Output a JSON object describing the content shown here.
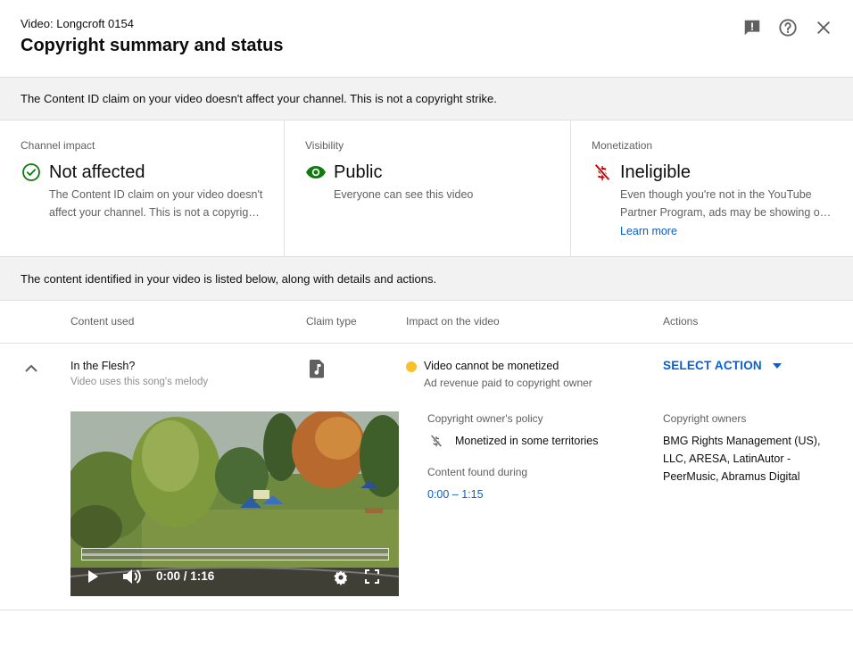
{
  "header": {
    "video_label": "Video: Longcroft 0154",
    "title": "Copyright summary and status",
    "icons": [
      "feedback-icon",
      "help-icon",
      "close-icon"
    ]
  },
  "notice": "The Content ID claim on your video doesn't affect your channel. This is not a copyright strike.",
  "cards": [
    {
      "label": "Channel impact",
      "icon": "check-circle-icon",
      "value": "Not affected",
      "description": "The Content ID claim on your video doesn't affect your channel. This is not a copyright strike."
    },
    {
      "label": "Visibility",
      "icon": "eye-icon",
      "value": "Public",
      "description": "Everyone can see this video"
    },
    {
      "label": "Monetization",
      "icon": "no-money-icon",
      "value": "Ineligible",
      "description": "Even though you're not in the YouTube Partner Program, ads may be showing on your video.",
      "link": "Learn more"
    }
  ],
  "content_notice": "The content identified in your video is listed below, along with details and actions.",
  "table": {
    "headers": [
      "Content used",
      "Claim type",
      "Impact on the video",
      "Actions"
    ],
    "rows": [
      {
        "title": "In the Flesh?",
        "subtitle": "Video uses this song's melody",
        "claim_type_icon": "music-note-icon",
        "impact": "Video cannot be monetized",
        "impact_sub": "Ad revenue paid to copyright owner",
        "action_label": "SELECT ACTION",
        "video": {
          "time": "0:00 / 1:16",
          "progress": 0.0
        },
        "policy_label": "Copyright owner's policy",
        "policy": "Monetized in some territories",
        "found_label": "Content found during",
        "found": "0:00 – 1:15",
        "owners_label": "Copyright owners",
        "owners": "BMG Rights Management (US), LLC, ARESA, LatinAutor - PeerMusic, Abramus Digital"
      }
    ]
  },
  "colors": {
    "accent": "#065fd4",
    "success": "#0f7b0f",
    "visibility": "#0f7b0f",
    "danger": "#c00000",
    "warning_dot": "#f9c02b",
    "banner_bg": "#f2f2f2"
  }
}
